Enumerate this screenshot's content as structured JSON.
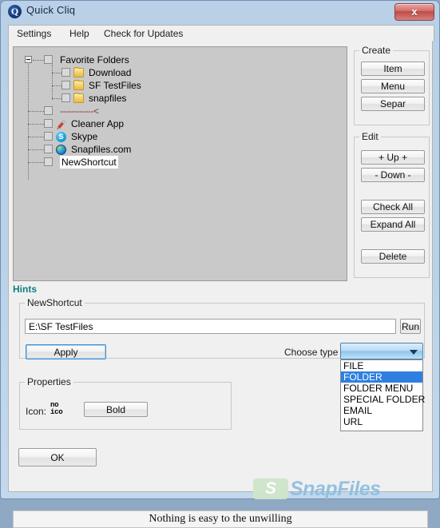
{
  "window": {
    "title": "Quick Cliq",
    "app_icon": "quick-cliq-q-icon",
    "close_label": "x"
  },
  "menubar": {
    "items": [
      {
        "label": "Settings"
      },
      {
        "label": "Help"
      },
      {
        "label": "Check for Updates"
      }
    ]
  },
  "tree": {
    "nodes": [
      {
        "label": "Favorite Folders",
        "icon": "none",
        "indent": 0,
        "expander": "collapse",
        "checked": false,
        "selected": false
      },
      {
        "label": "Download",
        "icon": "folder-icon",
        "indent": 1,
        "expander": "none",
        "checked": false,
        "selected": false
      },
      {
        "label": "SF TestFiles",
        "icon": "folder-icon",
        "indent": 1,
        "expander": "none",
        "checked": false,
        "selected": false
      },
      {
        "label": "snapfiles",
        "icon": "folder-icon",
        "indent": 1,
        "expander": "none",
        "checked": false,
        "selected": false
      },
      {
        "label": "------------<",
        "icon": "separator-icon",
        "indent": 0,
        "expander": "none",
        "checked": false,
        "selected": false
      },
      {
        "label": "Cleaner App",
        "icon": "cleaner-app-icon",
        "indent": 0,
        "expander": "none",
        "checked": false,
        "selected": false
      },
      {
        "label": "Skype",
        "icon": "skype-icon",
        "indent": 0,
        "expander": "none",
        "checked": false,
        "selected": false
      },
      {
        "label": "Snapfiles.com",
        "icon": "globe-icon",
        "indent": 0,
        "expander": "none",
        "checked": false,
        "selected": false
      },
      {
        "label": "NewShortcut",
        "icon": "none",
        "indent": 0,
        "expander": "none",
        "checked": false,
        "selected": true
      }
    ]
  },
  "create_group": {
    "caption": "Create",
    "buttons": [
      {
        "label": "Item"
      },
      {
        "label": "Menu"
      },
      {
        "label": "Separ"
      }
    ]
  },
  "edit_group": {
    "caption": "Edit",
    "buttons": [
      {
        "label": "+ Up +"
      },
      {
        "label": "- Down -"
      },
      {
        "label": "Check All"
      },
      {
        "label": "Expand All"
      },
      {
        "label": "Delete"
      }
    ]
  },
  "hints": {
    "label": "Hints"
  },
  "shortcut_group": {
    "caption": "NewShortcut",
    "path_value": "E:\\SF TestFiles",
    "path_placeholder": "",
    "run_label": "Run",
    "apply_label": "Apply",
    "choose_type_label": "Choose type",
    "type_selected": "",
    "type_options": [
      {
        "label": "FILE",
        "selected": false
      },
      {
        "label": "FOLDER",
        "selected": true
      },
      {
        "label": "FOLDER MENU",
        "selected": false
      },
      {
        "label": "SPECIAL FOLDER",
        "selected": false
      },
      {
        "label": "EMAIL",
        "selected": false
      },
      {
        "label": "URL",
        "selected": false
      }
    ]
  },
  "properties_group": {
    "caption": "Properties",
    "icon_label": "Icon:",
    "icon_value_line1": "no",
    "icon_value_line2": "ico",
    "bold_label": "Bold"
  },
  "ok_button": {
    "label": "OK"
  },
  "watermark": {
    "badge": "S",
    "text": "SnapFiles"
  },
  "statusbar": {
    "text": "Nothing is easy to the unwilling"
  },
  "colors": {
    "titlebar": "#bad2e8",
    "close_button": "#c14a44",
    "hints_text": "#0d7f82",
    "dropdown_highlight": "#2f7fe0",
    "tree_background": "#c9c9c9",
    "watermark_blue": "#8fbfe2",
    "watermark_green": "#cfe6cb"
  }
}
